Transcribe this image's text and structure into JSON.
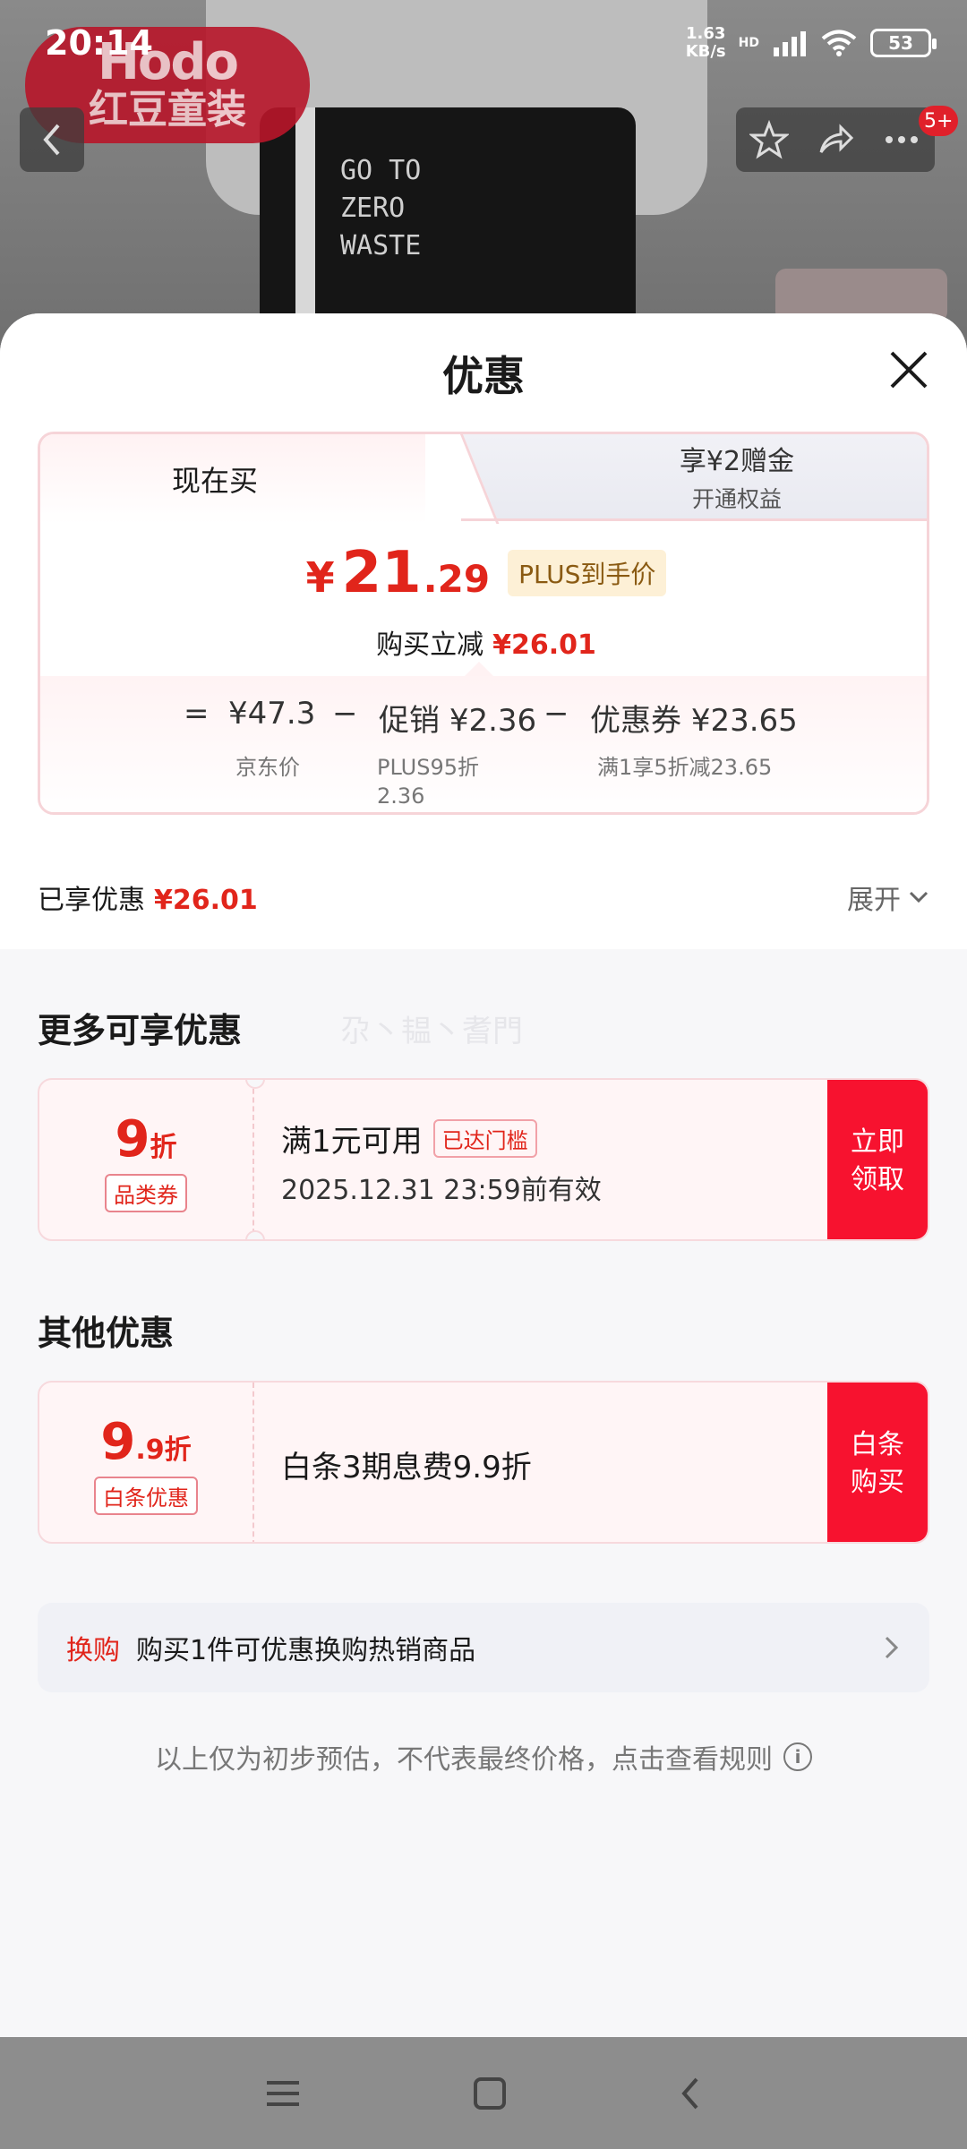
{
  "status_bar": {
    "time": "20:14",
    "network_speed_value": "1.63",
    "network_speed_unit": "KB/s",
    "network_tag": "HD",
    "battery": "53"
  },
  "background": {
    "brand_logo_text_line1": "Hodo",
    "brand_logo_text_line2": "红豆童装",
    "cart_badge": "5+",
    "shirt_print": "GO TO ZERO WASTE"
  },
  "sheet": {
    "title": "优惠",
    "tabs": [
      {
        "label": "现在买"
      },
      {
        "label": "享¥2赠金",
        "sub": "开通权益"
      }
    ],
    "price": {
      "currency": "¥",
      "integer": "21",
      "decimal": ".29",
      "tag": "PLUS到手价",
      "reduction_label": "购买立减",
      "reduction_value": "¥26.01"
    },
    "breakdown": {
      "eq": "=",
      "base": {
        "value": "¥47.3",
        "label": "京东价"
      },
      "op1": "−",
      "promo": {
        "label": "促销",
        "value": "¥2.36",
        "desc_line1": "PLUS95折",
        "desc_line2": "2.36"
      },
      "op2": "−",
      "coupon": {
        "label": "优惠券",
        "value": "¥23.65",
        "desc": "满1享5折减23.65"
      }
    },
    "enjoyed": {
      "label": "已享优惠",
      "value": "¥26.01"
    },
    "expand_label": "展开",
    "more_title": "更多可享优惠",
    "watermark": "尕丶韫丶耆門",
    "coupon1": {
      "value_big": "9",
      "value_unit": "折",
      "type_tag": "品类券",
      "condition": "满1元可用",
      "status_tag": "已达门槛",
      "validity": "2025.12.31 23:59前有效",
      "button": "立即领取"
    },
    "other_title": "其他优惠",
    "coupon2": {
      "value_big": "9",
      "value_small": ".9",
      "value_unit": "折",
      "type_tag": "白条优惠",
      "desc": "白条3期息费9.9折",
      "button": "白条购买"
    },
    "exchange": {
      "tag": "换购",
      "text": "购买1件可优惠换购热销商品"
    },
    "disclaimer": "以上仅为初步预估，不代表最终价格，点击查看规则"
  },
  "colors": {
    "accent_red": "#e1251b",
    "button_red": "#f7122f",
    "plus_gold_bg": "#fdf0d6"
  },
  "icons": [
    "back-arrow-icon",
    "star-icon",
    "share-icon",
    "more-icon",
    "close-icon",
    "chevron-down-icon",
    "chevron-right-icon",
    "info-icon",
    "menu-icon",
    "home-square-icon",
    "nav-back-icon"
  ]
}
